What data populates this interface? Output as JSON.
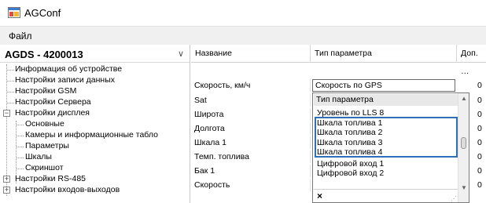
{
  "window": {
    "title": "AGConf",
    "icon": "app-window-icon"
  },
  "menu": {
    "items": [
      "Файл"
    ]
  },
  "device": {
    "name": "AGDS - 4200013",
    "arrow_icon": "chevron-down-icon"
  },
  "tree": {
    "items": [
      {
        "label": "Информация об устройстве"
      },
      {
        "label": "Настройки записи данных"
      },
      {
        "label": "Настройки GSM"
      },
      {
        "label": "Настройки Сервера"
      },
      {
        "label": "Настройки дисплея",
        "expander": "−"
      },
      {
        "label": "Основные"
      },
      {
        "label": "Камеры и информационные табло"
      },
      {
        "label": "Параметры"
      },
      {
        "label": "Шкалы"
      },
      {
        "label": "Скриншот"
      },
      {
        "label": "Настройки RS-485",
        "expander": "+"
      },
      {
        "label": "Настройки входов-выходов",
        "expander": "+"
      }
    ]
  },
  "grid": {
    "columns": [
      "Название",
      "Тип параметра",
      "Доп. …"
    ],
    "rows": [
      {
        "name": "Скорость, км/ч",
        "type": "Скорость по GPS",
        "extra": "0"
      },
      {
        "name": "Sat",
        "type": "",
        "extra": "0"
      },
      {
        "name": "Широта",
        "type": "",
        "extra": "0"
      },
      {
        "name": "Долгота",
        "type": "",
        "extra": "0"
      },
      {
        "name": "Шкала 1",
        "type": "",
        "extra": "0"
      },
      {
        "name": "Темп. топлива",
        "type": "",
        "extra": "0"
      },
      {
        "name": "Бак 1",
        "type": "",
        "extra": "0"
      },
      {
        "name": "Скорость",
        "type": "",
        "extra": "0"
      }
    ]
  },
  "dropdown": {
    "header": "Тип параметра",
    "options": [
      "Уровень по LLS  8",
      "Шкала топлива 1",
      "Шкала топлива 2",
      "Шкала топлива 3",
      "Шкала топлива 4",
      "Цифровой вход 1",
      "Цифровой вход 2"
    ],
    "clear_symbol": "×",
    "highlight_color": "#2e6fb6"
  }
}
